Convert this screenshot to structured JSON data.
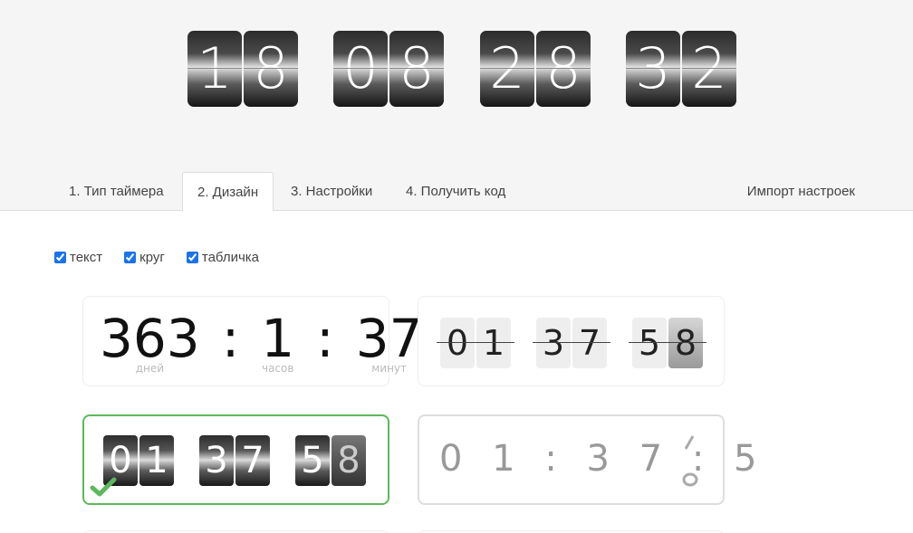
{
  "preview": {
    "digits": [
      "1",
      "8",
      "0",
      "8",
      "2",
      "8",
      "3",
      "2"
    ]
  },
  "tabs": [
    {
      "label": "1. Тип таймера"
    },
    {
      "label": "2. Дизайн"
    },
    {
      "label": "3. Настройки"
    },
    {
      "label": "4. Получить код"
    }
  ],
  "import_label": "Импорт настроек",
  "options": [
    {
      "label": "текст",
      "checked": true
    },
    {
      "label": "круг",
      "checked": true
    },
    {
      "label": "табличка",
      "checked": true
    }
  ],
  "design1": {
    "days": "363",
    "hours": "1",
    "minutes": "37",
    "sep": ":",
    "days_label": "дней",
    "hours_label": "часов",
    "minutes_label": "минут"
  },
  "design2": {
    "digits": [
      "0",
      "1",
      "3",
      "7",
      "5",
      "8"
    ]
  },
  "design3": {
    "digits": [
      "0",
      "1",
      "3",
      "7",
      "5",
      "8"
    ]
  },
  "design4": {
    "text": "0 1 : 3 7 : 5"
  },
  "colors": {
    "selected_border": "#5cb85c",
    "checkbox": "#1a73e8"
  }
}
